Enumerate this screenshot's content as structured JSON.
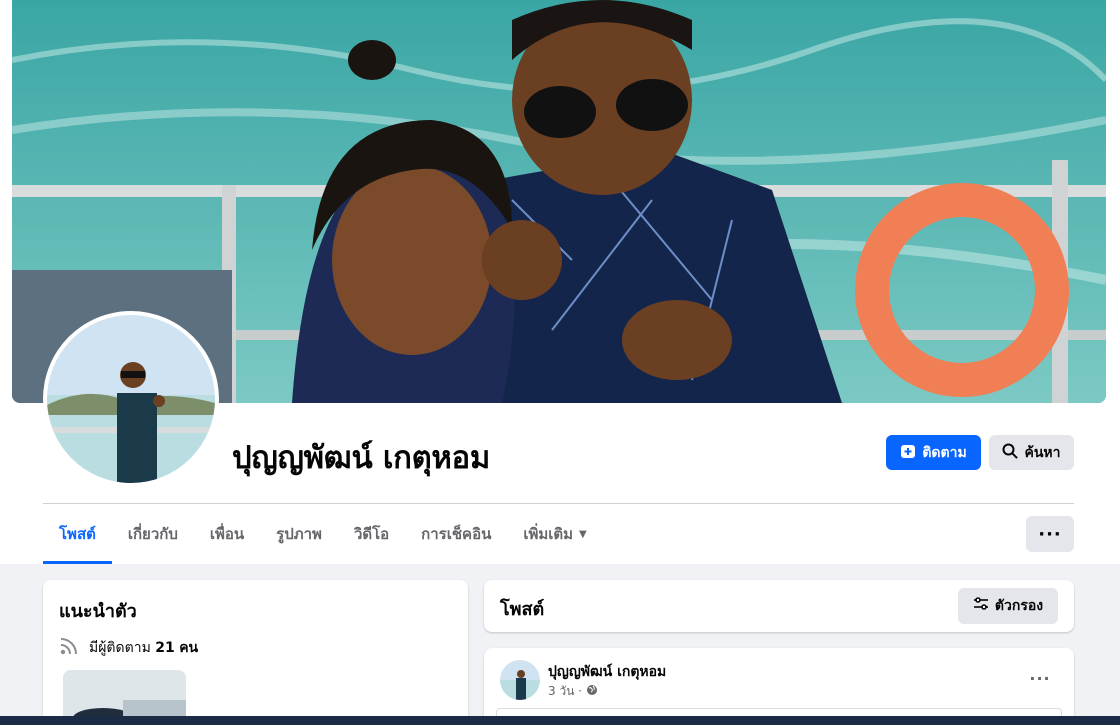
{
  "profile": {
    "name": "ปุญญพัฒน์ เกตุหอม"
  },
  "actions": {
    "follow_label": "ติดตาม",
    "search_label": "ค้นหา",
    "more_label": "···"
  },
  "tabs": [
    {
      "label": "โพสต์",
      "active": true
    },
    {
      "label": "เกี่ยวกับ",
      "active": false
    },
    {
      "label": "เพื่อน",
      "active": false
    },
    {
      "label": "รูปภาพ",
      "active": false
    },
    {
      "label": "วิดีโอ",
      "active": false
    },
    {
      "label": "การเช็คอิน",
      "active": false
    },
    {
      "label": "เพิ่มเติม",
      "active": false
    }
  ],
  "intro": {
    "title": "แนะนำตัว",
    "followers_prefix": "มีผู้ติดตาม",
    "followers_count": "21",
    "followers_suffix": "คน"
  },
  "posts": {
    "title": "โพสต์",
    "filter_label": "ตัวกรอง"
  },
  "post": {
    "author": "ปุญญพัฒน์ เกตุหอม",
    "time": "3 วัน ·"
  },
  "colors": {
    "accent": "#0866ff",
    "secondary_button": "#e4e6eb",
    "page_background": "#f0f2f5",
    "muted_text": "#65676b"
  },
  "icons": {
    "follow": "follow-plus-icon",
    "search": "search-icon",
    "more": "more-dots-icon",
    "rss": "rss-icon",
    "filter": "filter-icon",
    "globe": "globe-icon",
    "caret": "caret-down-icon"
  }
}
